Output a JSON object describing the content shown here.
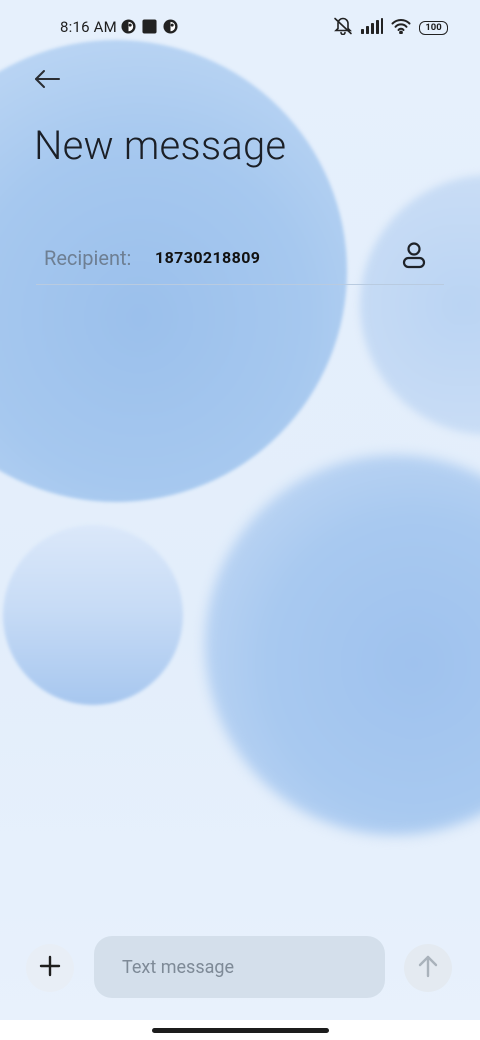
{
  "status_bar": {
    "time": "8:16 AM",
    "battery": "100",
    "left_icons": [
      "app-notification-icon",
      "square-notification-icon",
      "app-notification-icon"
    ],
    "right_icons": [
      "vibrate-icon",
      "signal-icon",
      "wifi-icon",
      "battery-icon"
    ]
  },
  "header": {
    "back_icon": "arrow-left-icon",
    "title": "New message"
  },
  "recipient": {
    "label": "Recipient:",
    "value": "18730218809",
    "contact_icon": "person-icon"
  },
  "compose": {
    "attach_icon": "plus-icon",
    "placeholder": "Text message",
    "value": "",
    "send_icon": "arrow-up-icon"
  },
  "colors": {
    "background": "#e6f0fc",
    "bubble": "#9fc2ee",
    "input_background": "#d4dfeb",
    "send_disabled": "#a9b2bb"
  }
}
